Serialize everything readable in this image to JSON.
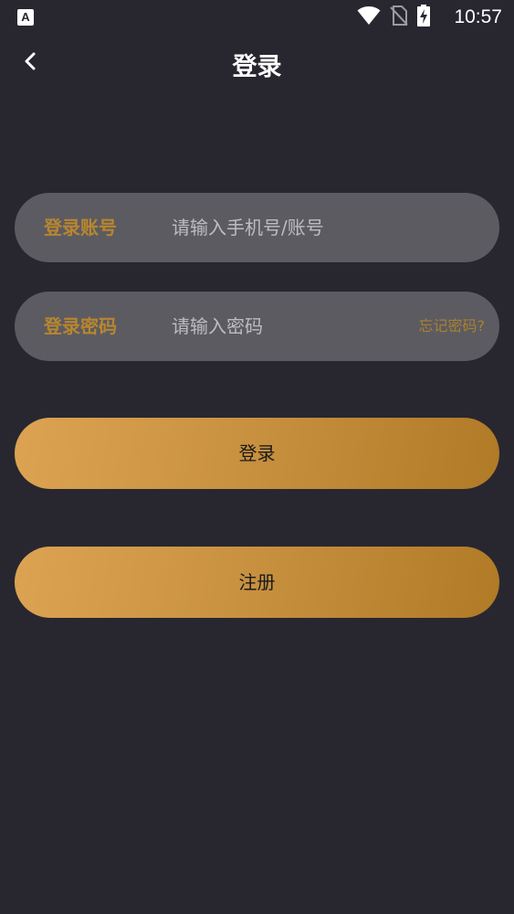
{
  "status_bar": {
    "app_icon_letter": "A",
    "time": "10:57",
    "icons": [
      "wifi-icon",
      "no-sim-icon",
      "battery-charging-icon"
    ]
  },
  "header": {
    "back_icon": "chevron-left-icon",
    "title": "登录"
  },
  "form": {
    "account": {
      "label": "登录账号",
      "placeholder": "请输入手机号/账号",
      "value": ""
    },
    "password": {
      "label": "登录密码",
      "placeholder": "请输入密码",
      "value": "",
      "forgot_label": "忘记密码?"
    }
  },
  "actions": {
    "login_label": "登录",
    "register_label": "注册"
  },
  "colors": {
    "background": "#282730",
    "field_background": "#5c5b61",
    "accent_gold": "#b8862e",
    "button_gradient_start": "#dca352",
    "button_gradient_end": "#b07a26"
  }
}
